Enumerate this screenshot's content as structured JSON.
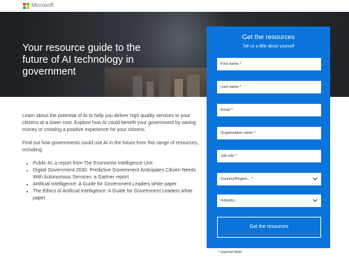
{
  "brand": {
    "name": "Microsoft"
  },
  "hero": {
    "title": "Your resource guide to the future of AI technology in government"
  },
  "intro": {
    "paragraph1": "Learn about the potential of AI to help you deliver high quality services to your citizens at a lower cost. Explore how AI could benefit your government by saving money or creating a positive experience for your citizens.",
    "paragraph2": "Find out how governments could use AI in the future from this range of resources, including:",
    "resources": [
      "Public AI, a report from The Economist Intelligence Unit",
      "Digital Government 2030: Predictive Government Anticipates Citizen Needs With Autonomous Services, a Gartner report",
      "Artificial Intelligence: A Guide for Government Leaders white paper",
      "The Ethics of Artificial Intelligence: A Guide for Government Leaders white paper"
    ]
  },
  "form": {
    "title": "Get the resources",
    "subtitle": "Tell us a little about yourself",
    "first_name": "First name *",
    "last_name": "Last name *",
    "email": "Email *",
    "organization": "Organization name *",
    "job_role": "Job role *",
    "country": "Country/Region... *",
    "industry": "Industry...",
    "submit": "Get the resources",
    "required_note": "* required fields"
  },
  "colors": {
    "panel": "#0a74da",
    "hero_text": "#ffffff"
  }
}
